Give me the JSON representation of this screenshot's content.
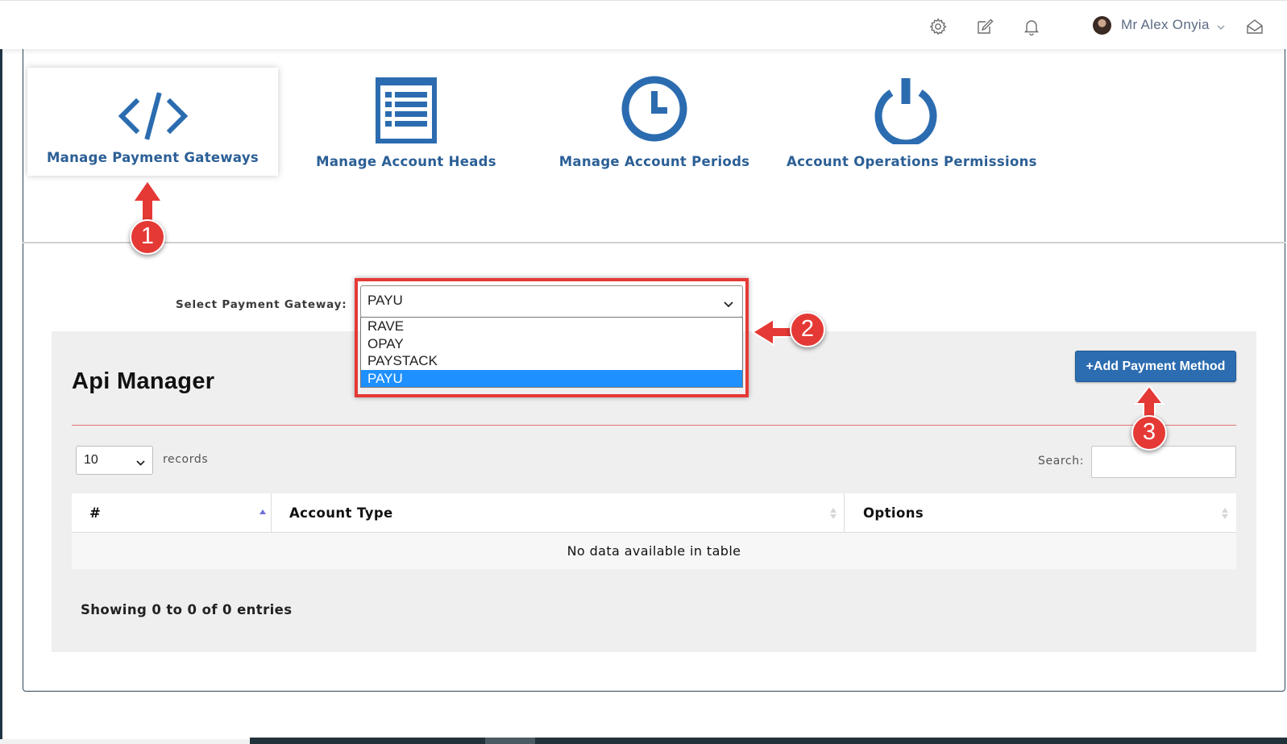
{
  "header": {
    "icons": [
      "settings-icon",
      "edit-icon",
      "bell-icon",
      "inbox-icon"
    ],
    "user_name": "Mr Alex Onyia"
  },
  "tiles": [
    {
      "label": "Manage Payment Gateways",
      "icon": "code-icon",
      "active": true
    },
    {
      "label": "Manage Account Heads",
      "icon": "list-document-icon",
      "active": false
    },
    {
      "label": "Manage Account Periods",
      "icon": "clock-icon",
      "active": false
    },
    {
      "label": "Account Operations Permissions",
      "icon": "power-icon",
      "active": false
    }
  ],
  "gateway": {
    "label": "Select Payment Gateway:",
    "selected": "PAYU",
    "options": [
      "RAVE",
      "OPAY",
      "PAYSTACK",
      "PAYU"
    ]
  },
  "api_manager": {
    "title": "Api Manager",
    "add_button": "+Add Payment Method",
    "page_length": "10",
    "records_label": "records",
    "search_label": "Search:",
    "search_value": "",
    "columns": [
      "#",
      "Account Type",
      "Options"
    ],
    "empty_message": "No data available in table",
    "info": "Showing 0 to 0 of 0 entries"
  },
  "annotations": [
    "1",
    "2",
    "3"
  ],
  "colors": {
    "accent": "#2b5f96",
    "button": "#2c6cb0",
    "highlight": "#e53935",
    "selected_option": "#1e90ff"
  }
}
